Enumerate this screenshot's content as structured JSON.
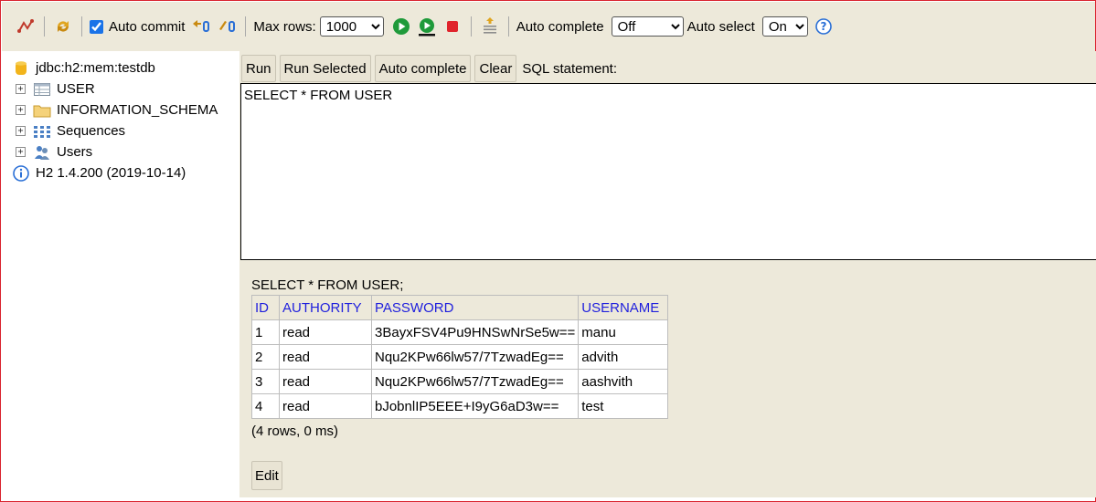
{
  "toolbar": {
    "auto_commit_label": "Auto commit",
    "auto_commit_checked": true,
    "max_rows_label": "Max rows:",
    "max_rows_value": "1000",
    "auto_complete_label": "Auto complete",
    "auto_complete_value": "Off",
    "auto_select_label": "Auto select",
    "auto_select_value": "On",
    "colors": {
      "run": "#1f9a3a",
      "stop": "#e0242c",
      "help": "#2a6fd6"
    }
  },
  "tree": {
    "connection": "jdbc:h2:mem:testdb",
    "items": [
      {
        "label": "USER",
        "icon": "table-icon"
      },
      {
        "label": "INFORMATION_SCHEMA",
        "icon": "folder-icon"
      },
      {
        "label": "Sequences",
        "icon": "sequence-icon"
      },
      {
        "label": "Users",
        "icon": "users-icon"
      }
    ],
    "version": "H2 1.4.200 (2019-10-14)"
  },
  "buttons": {
    "run": "Run",
    "run_selected": "Run Selected",
    "auto_complete": "Auto complete",
    "clear": "Clear",
    "sql_label": "SQL statement:"
  },
  "editor": {
    "text": "SELECT * FROM USER"
  },
  "result": {
    "query": "SELECT * FROM USER;",
    "columns": [
      "ID",
      "AUTHORITY",
      "PASSWORD",
      "USERNAME"
    ],
    "rows": [
      [
        "1",
        "read",
        "3BayxFSV4Pu9HNSwNrSe5w==",
        "manu"
      ],
      [
        "2",
        "read",
        "Nqu2KPw66lw57/7TzwadEg==",
        "advith"
      ],
      [
        "3",
        "read",
        "Nqu2KPw66lw57/7TzwadEg==",
        "aashvith"
      ],
      [
        "4",
        "read",
        "bJobnlIP5EEE+I9yG6aD3w==",
        "test"
      ]
    ],
    "summary": "(4 rows, 0 ms)",
    "edit_label": "Edit"
  }
}
